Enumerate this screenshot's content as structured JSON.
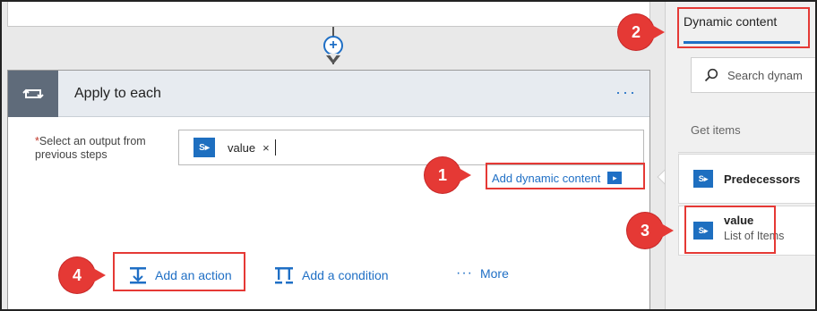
{
  "apply": {
    "title": "Apply to each",
    "more_dots": "···",
    "required_marker": "*",
    "field_label": "Select an output from previous steps",
    "token_value": "value",
    "token_remove": "×",
    "add_dynamic_content": "Add dynamic content"
  },
  "actions": {
    "add_action": "Add an action",
    "add_condition": "Add a condition",
    "more_dots": "···",
    "more": "More"
  },
  "panel": {
    "tab": "Dynamic content",
    "search_placeholder": "Search dynam",
    "group": "Get items",
    "items": [
      {
        "title": "Predecessors",
        "sub": ""
      },
      {
        "title": "value",
        "sub": "List of Items"
      }
    ]
  },
  "badges": {
    "sp": "S"
  },
  "annotations": [
    "1",
    "2",
    "3",
    "4"
  ],
  "colors": {
    "accent": "#1f6fc5",
    "callout": "#e53935",
    "header": "#5f6b7a"
  }
}
